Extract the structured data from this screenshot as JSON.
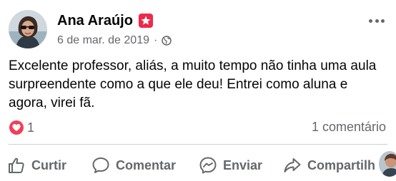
{
  "post": {
    "author": "Ana Araújo",
    "date": "6 de mar. de 2019",
    "meta_separator": "·",
    "text": "Excelente professor, aliás, a muito tempo não tinha uma aula surpreendente como a que ele deu! Entrei como aluna e agora, virei fã.",
    "reaction_count": "1",
    "comments_label": "1 comentário",
    "audience_icon": "globe-icon",
    "badge_icon": "star-badge-icon",
    "reaction_icon": "love-icon"
  },
  "actions": {
    "like_label": "Curtir",
    "comment_label": "Comentar",
    "send_label": "Enviar",
    "share_label": "Compartilh"
  },
  "colors": {
    "badge": "#f02849",
    "love": "#f33e58",
    "secondary_text": "#65676b",
    "divider": "#ced0d4"
  }
}
